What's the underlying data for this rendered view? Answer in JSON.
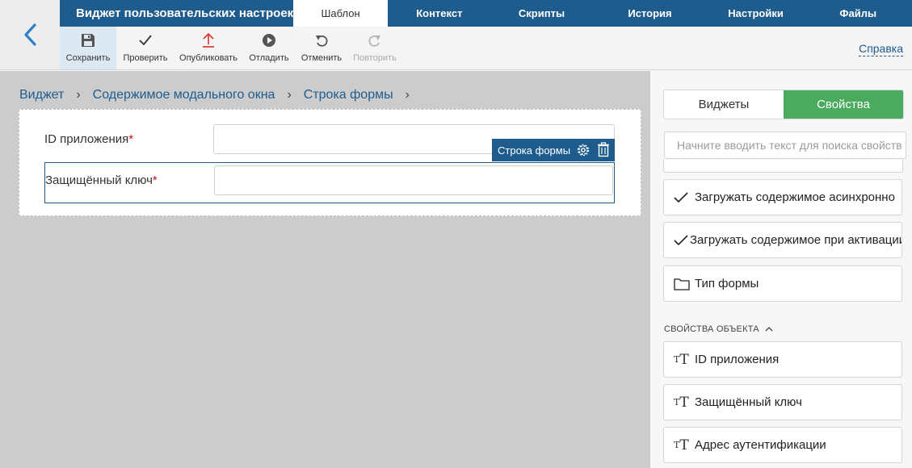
{
  "header": {
    "app_title": "Виджет пользовательских настроек",
    "tabs": [
      {
        "label": "Шаблон",
        "active": true
      },
      {
        "label": "Контекст",
        "active": false
      },
      {
        "label": "Скрипты",
        "active": false
      },
      {
        "label": "История",
        "active": false
      },
      {
        "label": "Настройки",
        "active": false
      },
      {
        "label": "Файлы",
        "active": false
      }
    ]
  },
  "toolbar": {
    "save_label": "Сохранить",
    "check_label": "Проверить",
    "publish_label": "Опубликовать",
    "debug_label": "Отладить",
    "undo_label": "Отменить",
    "redo_label": "Повторить",
    "help_label": "Справка"
  },
  "breadcrumb": {
    "items": [
      "Виджет",
      "Содержимое модального окна",
      "Строка формы"
    ]
  },
  "form": {
    "field1_label": "ID приложения",
    "field2_label": "Защищённый ключ",
    "required_mark": "*",
    "row_toolbar_label": "Строка формы"
  },
  "panel": {
    "tab_widgets": "Виджеты",
    "tab_properties": "Свойства",
    "search_placeholder": "Начните вводить текст для поиска свойств",
    "items": [
      {
        "label": "Загружать содержимое асинхронно",
        "icon": "check-icon"
      },
      {
        "label": "Загружать содержимое при активации",
        "icon": "check-icon"
      },
      {
        "label": "Тип формы",
        "icon": "folder-icon"
      }
    ],
    "section_title": "СВОЙСТВА ОБЪЕКТА",
    "object_items": [
      {
        "label": "ID приложения",
        "icon": "text-type-icon"
      },
      {
        "label": "Защищённый ключ",
        "icon": "text-type-icon"
      },
      {
        "label": "Адрес аутентификации",
        "icon": "text-type-icon"
      }
    ]
  },
  "colors": {
    "nav_blue": "#1e5c8e",
    "accent_green": "#4aaa5e",
    "required_red": "#c0141d",
    "canvas_gray": "#cccccc"
  }
}
